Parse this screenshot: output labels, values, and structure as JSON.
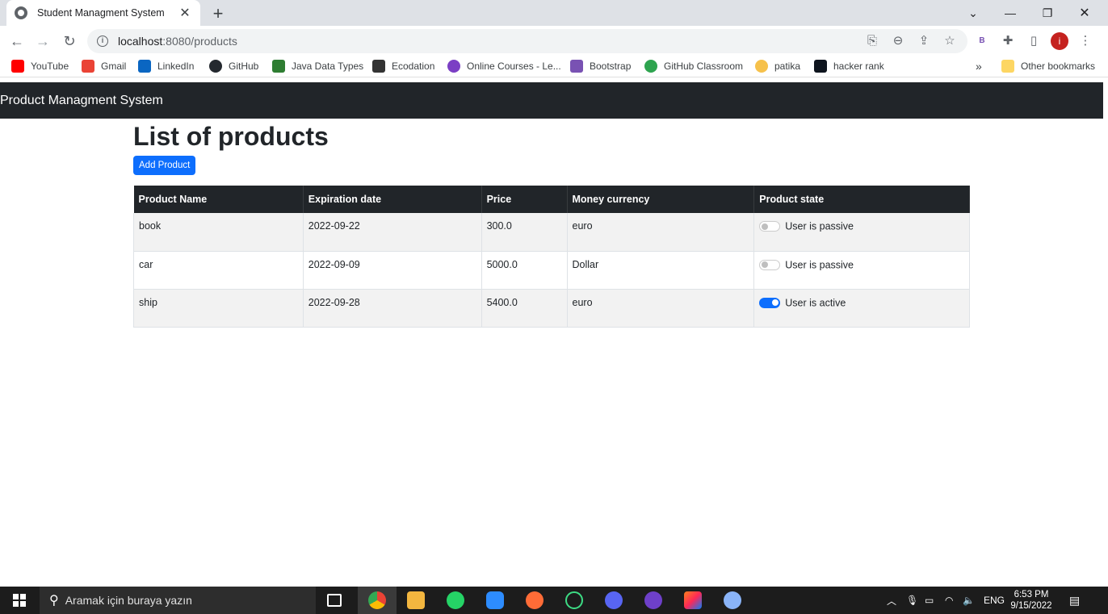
{
  "browser": {
    "tab_title": "Student Managment System",
    "url_host": "localhost",
    "url_path": ":8080/products",
    "avatar_letter": "i",
    "bookmarks": [
      {
        "label": "YouTube",
        "color": "#ff0000"
      },
      {
        "label": "Gmail",
        "color": "#ea4335"
      },
      {
        "label": "LinkedIn",
        "color": "#0a66c2"
      },
      {
        "label": "GitHub",
        "color": "#24292f"
      },
      {
        "label": "Java Data Types",
        "color": "#2e7d32"
      },
      {
        "label": "Ecodation",
        "color": "#333333"
      },
      {
        "label": "Online Courses - Le...",
        "color": "#7b3fc4"
      },
      {
        "label": "Bootstrap",
        "color": "#7952b3"
      },
      {
        "label": "GitHub Classroom",
        "color": "#2ea44f"
      },
      {
        "label": "patika",
        "color": "#f6c14b"
      },
      {
        "label": "hacker rank",
        "color": "#0e141e"
      }
    ],
    "other_bookmarks": "Other bookmarks",
    "more_bookmarks": "»"
  },
  "app": {
    "brand": "Product Managment System",
    "page_title": "List of products",
    "add_button": "Add Product",
    "columns": [
      "Product Name",
      "Expiration date",
      "Price",
      "Money currency",
      "Product state"
    ],
    "rows": [
      {
        "name": "book",
        "expiration": "2022-09-22",
        "price": "300.0",
        "currency": "euro",
        "active": false,
        "state_label": "User is passive"
      },
      {
        "name": "car",
        "expiration": "2022-09-09",
        "price": "5000.0",
        "currency": "Dollar",
        "active": false,
        "state_label": "User is passive"
      },
      {
        "name": "ship",
        "expiration": "2022-09-28",
        "price": "5400.0",
        "currency": "euro",
        "active": true,
        "state_label": "User is active"
      }
    ]
  },
  "taskbar": {
    "search_placeholder": "Aramak için buraya yazın",
    "language": "ENG",
    "time": "6:53 PM",
    "date": "9/15/2022"
  }
}
